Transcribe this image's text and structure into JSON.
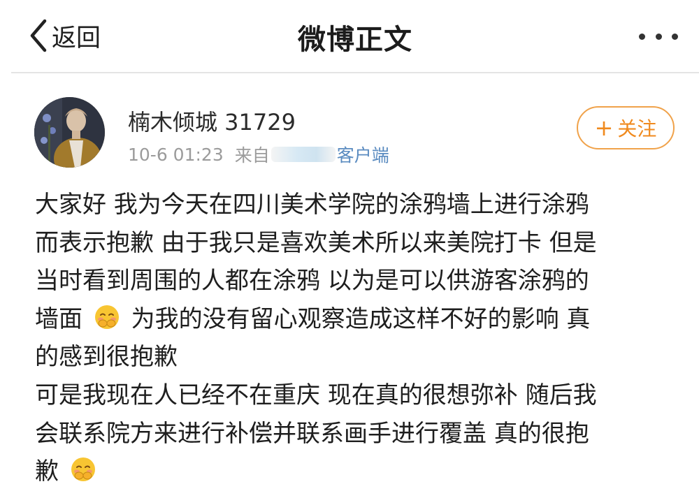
{
  "navbar": {
    "back_label": "返回",
    "title": "微博正文",
    "back_icon": "chevron-left-icon",
    "more_icon": "more-dots-icon"
  },
  "post_author": {
    "name": "楠木倾城 31729",
    "time": "10-6 01:23",
    "source_prefix": "来自",
    "source_suffix": "客户端",
    "follow_label": "关注",
    "follow_icon": "plus-icon"
  },
  "post_content": {
    "lines": [
      "大家好  我为今天在四川美术学院的涂鸦墙上进行涂鸦",
      "而表示抱歉 由于我只是喜欢美术所以来美院打卡 但是",
      "当时看到周围的人都在涂鸦 以为是可以供游客涂鸦的",
      "墙面",
      "为我的没有留心观察造成这样不好的影响 真",
      "的感到很抱歉",
      "可是我现在人已经不在重庆 现在真的很想弥补 随后我",
      "会联系院方来进行补偿并联系画手进行覆盖 真的很抱",
      "歉"
    ],
    "emoji": "embarrassed-face-emoji"
  },
  "colors": {
    "accent": "#f08a1e",
    "link": "#5a8bc0",
    "meta": "#9b9b9b"
  }
}
